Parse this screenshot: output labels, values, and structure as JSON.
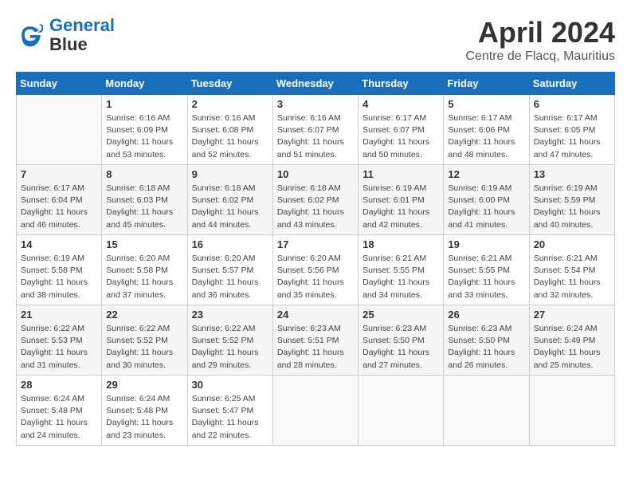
{
  "header": {
    "logo_line1": "General",
    "logo_line2": "Blue",
    "month_year": "April 2024",
    "location": "Centre de Flacq, Mauritius"
  },
  "days_of_week": [
    "Sunday",
    "Monday",
    "Tuesday",
    "Wednesday",
    "Thursday",
    "Friday",
    "Saturday"
  ],
  "weeks": [
    [
      {
        "num": "",
        "empty": true
      },
      {
        "num": "1",
        "sunrise": "6:16 AM",
        "sunset": "6:09 PM",
        "daylight": "11 hours and 53 minutes."
      },
      {
        "num": "2",
        "sunrise": "6:16 AM",
        "sunset": "6:08 PM",
        "daylight": "11 hours and 52 minutes."
      },
      {
        "num": "3",
        "sunrise": "6:16 AM",
        "sunset": "6:07 PM",
        "daylight": "11 hours and 51 minutes."
      },
      {
        "num": "4",
        "sunrise": "6:17 AM",
        "sunset": "6:07 PM",
        "daylight": "11 hours and 50 minutes."
      },
      {
        "num": "5",
        "sunrise": "6:17 AM",
        "sunset": "6:06 PM",
        "daylight": "11 hours and 48 minutes."
      },
      {
        "num": "6",
        "sunrise": "6:17 AM",
        "sunset": "6:05 PM",
        "daylight": "11 hours and 47 minutes."
      }
    ],
    [
      {
        "num": "7",
        "sunrise": "6:17 AM",
        "sunset": "6:04 PM",
        "daylight": "11 hours and 46 minutes."
      },
      {
        "num": "8",
        "sunrise": "6:18 AM",
        "sunset": "6:03 PM",
        "daylight": "11 hours and 45 minutes."
      },
      {
        "num": "9",
        "sunrise": "6:18 AM",
        "sunset": "6:02 PM",
        "daylight": "11 hours and 44 minutes."
      },
      {
        "num": "10",
        "sunrise": "6:18 AM",
        "sunset": "6:02 PM",
        "daylight": "11 hours and 43 minutes."
      },
      {
        "num": "11",
        "sunrise": "6:19 AM",
        "sunset": "6:01 PM",
        "daylight": "11 hours and 42 minutes."
      },
      {
        "num": "12",
        "sunrise": "6:19 AM",
        "sunset": "6:00 PM",
        "daylight": "11 hours and 41 minutes."
      },
      {
        "num": "13",
        "sunrise": "6:19 AM",
        "sunset": "5:59 PM",
        "daylight": "11 hours and 40 minutes."
      }
    ],
    [
      {
        "num": "14",
        "sunrise": "6:19 AM",
        "sunset": "5:58 PM",
        "daylight": "11 hours and 38 minutes."
      },
      {
        "num": "15",
        "sunrise": "6:20 AM",
        "sunset": "5:58 PM",
        "daylight": "11 hours and 37 minutes."
      },
      {
        "num": "16",
        "sunrise": "6:20 AM",
        "sunset": "5:57 PM",
        "daylight": "11 hours and 36 minutes."
      },
      {
        "num": "17",
        "sunrise": "6:20 AM",
        "sunset": "5:56 PM",
        "daylight": "11 hours and 35 minutes."
      },
      {
        "num": "18",
        "sunrise": "6:21 AM",
        "sunset": "5:55 PM",
        "daylight": "11 hours and 34 minutes."
      },
      {
        "num": "19",
        "sunrise": "6:21 AM",
        "sunset": "5:55 PM",
        "daylight": "11 hours and 33 minutes."
      },
      {
        "num": "20",
        "sunrise": "6:21 AM",
        "sunset": "5:54 PM",
        "daylight": "11 hours and 32 minutes."
      }
    ],
    [
      {
        "num": "21",
        "sunrise": "6:22 AM",
        "sunset": "5:53 PM",
        "daylight": "11 hours and 31 minutes."
      },
      {
        "num": "22",
        "sunrise": "6:22 AM",
        "sunset": "5:52 PM",
        "daylight": "11 hours and 30 minutes."
      },
      {
        "num": "23",
        "sunrise": "6:22 AM",
        "sunset": "5:52 PM",
        "daylight": "11 hours and 29 minutes."
      },
      {
        "num": "24",
        "sunrise": "6:23 AM",
        "sunset": "5:51 PM",
        "daylight": "11 hours and 28 minutes."
      },
      {
        "num": "25",
        "sunrise": "6:23 AM",
        "sunset": "5:50 PM",
        "daylight": "11 hours and 27 minutes."
      },
      {
        "num": "26",
        "sunrise": "6:23 AM",
        "sunset": "5:50 PM",
        "daylight": "11 hours and 26 minutes."
      },
      {
        "num": "27",
        "sunrise": "6:24 AM",
        "sunset": "5:49 PM",
        "daylight": "11 hours and 25 minutes."
      }
    ],
    [
      {
        "num": "28",
        "sunrise": "6:24 AM",
        "sunset": "5:48 PM",
        "daylight": "11 hours and 24 minutes."
      },
      {
        "num": "29",
        "sunrise": "6:24 AM",
        "sunset": "5:48 PM",
        "daylight": "11 hours and 23 minutes."
      },
      {
        "num": "30",
        "sunrise": "6:25 AM",
        "sunset": "5:47 PM",
        "daylight": "11 hours and 22 minutes."
      },
      {
        "num": "",
        "empty": true
      },
      {
        "num": "",
        "empty": true
      },
      {
        "num": "",
        "empty": true
      },
      {
        "num": "",
        "empty": true
      }
    ]
  ]
}
